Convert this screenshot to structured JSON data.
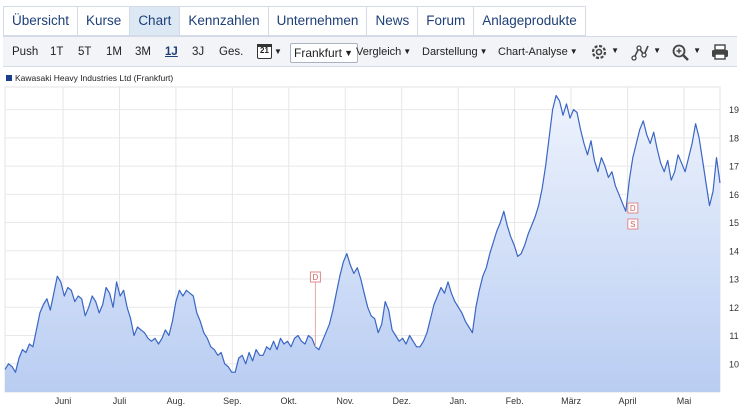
{
  "tabs": [
    {
      "label": "Übersicht",
      "name": "tab-uebersicht",
      "active": false
    },
    {
      "label": "Kurse",
      "name": "tab-kurse",
      "active": false
    },
    {
      "label": "Chart",
      "name": "tab-chart",
      "active": true
    },
    {
      "label": "Kennzahlen",
      "name": "tab-kennzahlen",
      "active": false
    },
    {
      "label": "Unternehmen",
      "name": "tab-unternehmen",
      "active": false
    },
    {
      "label": "News",
      "name": "tab-news",
      "active": false
    },
    {
      "label": "Forum",
      "name": "tab-forum",
      "active": false
    },
    {
      "label": "Anlageprodukte",
      "name": "tab-anlageprodukte",
      "active": false
    }
  ],
  "toolbar": {
    "periods": [
      "Push",
      "1T",
      "5T",
      "1M",
      "3M",
      "1J",
      "3J",
      "Ges."
    ],
    "active_period": "1J",
    "calendar_day": "21",
    "exchange": "Frankfurt",
    "menus": [
      "Vergleich",
      "Darstellung",
      "Chart-Analyse"
    ],
    "icons": [
      "gear-icon",
      "indicator-icon",
      "zoom-icon",
      "print-icon"
    ]
  },
  "legend": {
    "label": "Kawasaki Heavy Industries Ltd (Frankfurt)",
    "color": "#1c3e8c"
  },
  "chart_data": {
    "type": "area",
    "series": [
      {
        "name": "Kawasaki Heavy Industries Ltd (Frankfurt)",
        "values": [
          9.8,
          10.0,
          9.9,
          9.7,
          10.2,
          10.5,
          10.4,
          10.7,
          10.6,
          11.2,
          11.8,
          12.1,
          12.3,
          11.9,
          12.5,
          13.1,
          12.9,
          12.4,
          12.7,
          12.6,
          12.2,
          12.4,
          12.3,
          11.7,
          12.0,
          12.4,
          12.2,
          11.8,
          12.1,
          12.7,
          12.5,
          12.0,
          12.9,
          12.4,
          12.6,
          12.0,
          11.6,
          11.0,
          11.3,
          11.2,
          11.1,
          10.9,
          10.8,
          10.9,
          10.7,
          10.9,
          11.2,
          11.0,
          11.5,
          12.2,
          12.6,
          12.4,
          12.6,
          12.5,
          12.4,
          11.8,
          11.5,
          11.1,
          10.9,
          10.6,
          10.5,
          10.3,
          10.4,
          10.0,
          9.9,
          9.7,
          9.7,
          10.2,
          10.3,
          10.0,
          10.4,
          10.1,
          10.5,
          10.3,
          10.3,
          10.6,
          10.5,
          10.8,
          10.5,
          10.9,
          10.7,
          10.8,
          10.6,
          10.9,
          11.0,
          10.8,
          10.7,
          11.0,
          10.9,
          10.6,
          10.5,
          10.8,
          11.1,
          11.4,
          11.9,
          12.5,
          13.1,
          13.6,
          13.9,
          13.5,
          13.2,
          13.4,
          13.0,
          12.5,
          12.0,
          11.7,
          11.6,
          11.1,
          11.4,
          12.2,
          11.9,
          11.2,
          11.0,
          10.8,
          10.9,
          10.7,
          11.0,
          10.8,
          10.6,
          10.6,
          10.8,
          11.1,
          11.6,
          12.1,
          12.4,
          12.7,
          12.5,
          12.9,
          12.5,
          12.2,
          12.0,
          11.8,
          11.5,
          11.3,
          11.1,
          12.0,
          12.6,
          13.1,
          13.4,
          13.9,
          14.3,
          14.7,
          15.0,
          15.4,
          14.9,
          14.5,
          14.2,
          13.8,
          13.9,
          14.2,
          14.6,
          14.9,
          15.2,
          15.6,
          16.2,
          17.0,
          18.0,
          19.0,
          19.5,
          19.3,
          18.8,
          19.2,
          18.7,
          19.0,
          18.9,
          18.3,
          17.8,
          17.4,
          17.9,
          17.2,
          16.8,
          17.3,
          17.0,
          16.6,
          16.8,
          16.3,
          16.0,
          15.7,
          15.4,
          16.5,
          17.3,
          17.8,
          18.3,
          18.6,
          18.1,
          17.8,
          18.2,
          17.6,
          17.1,
          16.8,
          17.2,
          16.5,
          16.8,
          17.4,
          17.1,
          16.8,
          17.3,
          17.8,
          18.5,
          18.0,
          17.2,
          16.4,
          15.6,
          16.1,
          17.3,
          16.4
        ]
      }
    ],
    "x_labels": [
      "Juni",
      "Juli",
      "Aug.",
      "Sep.",
      "Okt.",
      "Nov.",
      "Dez.",
      "Jan.",
      "Feb.",
      "März",
      "April",
      "Mai"
    ],
    "y_ticks": [
      10,
      11,
      12,
      13,
      14,
      15,
      16,
      17,
      18,
      19
    ],
    "ylim": [
      9,
      19.8
    ],
    "grid": true,
    "y_axis_side": "right",
    "line_color": "#3a66c4",
    "fill_top_color": "#eef3fd",
    "fill_bottom_color": "#b9cdf2",
    "event_markers": [
      {
        "label": "D",
        "at_index": 89
      },
      {
        "label": "D",
        "at_index": 180
      },
      {
        "label": "S",
        "at_index": 180
      }
    ]
  }
}
